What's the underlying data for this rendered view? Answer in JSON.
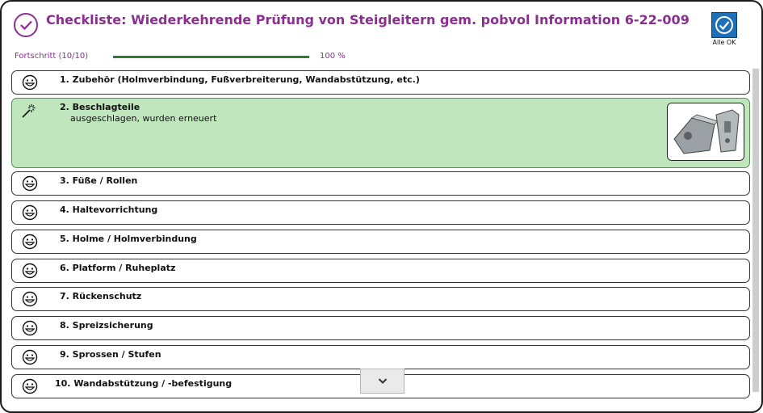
{
  "header": {
    "title": "Checkliste: Wiederkehrende Prüfung von Steigleitern gem. pobvol Information 6-22-009",
    "title_icon": "check-circle-icon",
    "all_ok_label": "Alle OK",
    "all_ok_icon": "check-circle-icon"
  },
  "progress": {
    "label": "Fortschritt (10/10)",
    "percent_text": "100 %",
    "fraction": 1.0
  },
  "items": [
    {
      "label": "1. Zubehör (Holmverbindung, Fußverbreiterung, Wandabstützung, etc.)",
      "icon": "smiley-icon"
    },
    {
      "label": "2. Beschlagteile",
      "note": "ausgeschlagen, wurden erneuert",
      "icon": "magic-wand-icon",
      "image": "fitting-photo"
    },
    {
      "label": "3. Füße / Rollen",
      "icon": "smiley-icon"
    },
    {
      "label": "4. Haltevorrichtung",
      "icon": "smiley-icon"
    },
    {
      "label": "5. Holme / Holmverbindung",
      "icon": "smiley-icon"
    },
    {
      "label": "6. Platform / Ruheplatz",
      "icon": "smiley-icon"
    },
    {
      "label": "7. Rückenschutz",
      "icon": "smiley-icon"
    },
    {
      "label": "8. Spreizsicherung",
      "icon": "smiley-icon"
    },
    {
      "label": "9. Sprossen / Stufen",
      "icon": "smiley-icon"
    },
    {
      "label": "10. Wandabstützung / -befestigung",
      "icon": "smiley-icon"
    }
  ],
  "colors": {
    "accent": "#8a2f8f",
    "active_row": "#bfe6bd",
    "progress": "#2e7d32",
    "button": "#1f6fb8"
  },
  "scroll_down_icon": "chevron-down-icon"
}
